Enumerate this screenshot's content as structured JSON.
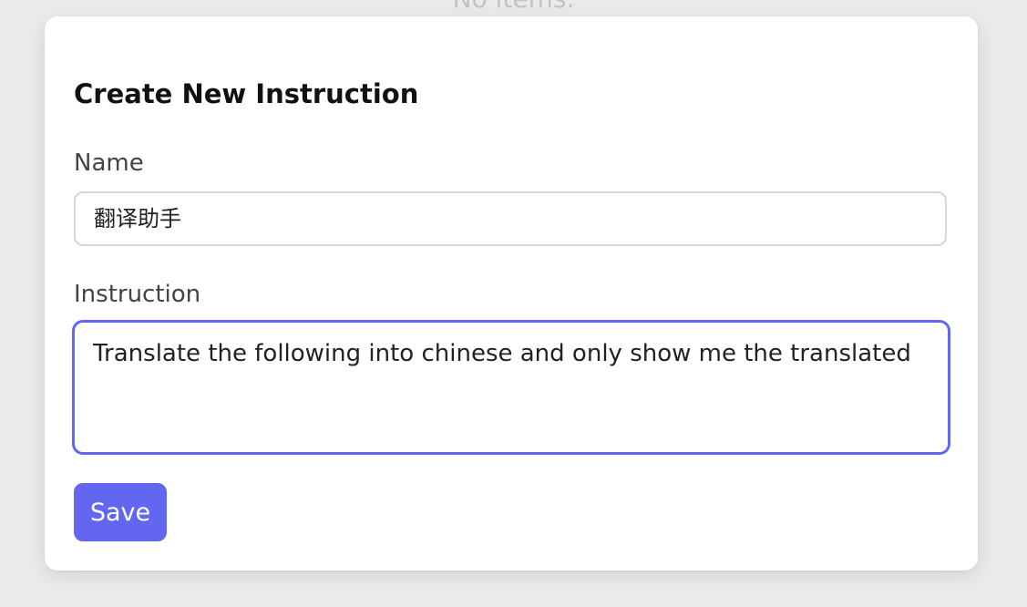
{
  "background": {
    "empty_text": "No items."
  },
  "form": {
    "title": "Create New Instruction",
    "name_label": "Name",
    "name_value": "翻译助手",
    "instruction_label": "Instruction",
    "instruction_value": "Translate the following into chinese and only show me the translated",
    "save_label": "Save"
  },
  "colors": {
    "accent": "#6366f1",
    "background": "#ebebed",
    "card": "#ffffff"
  }
}
